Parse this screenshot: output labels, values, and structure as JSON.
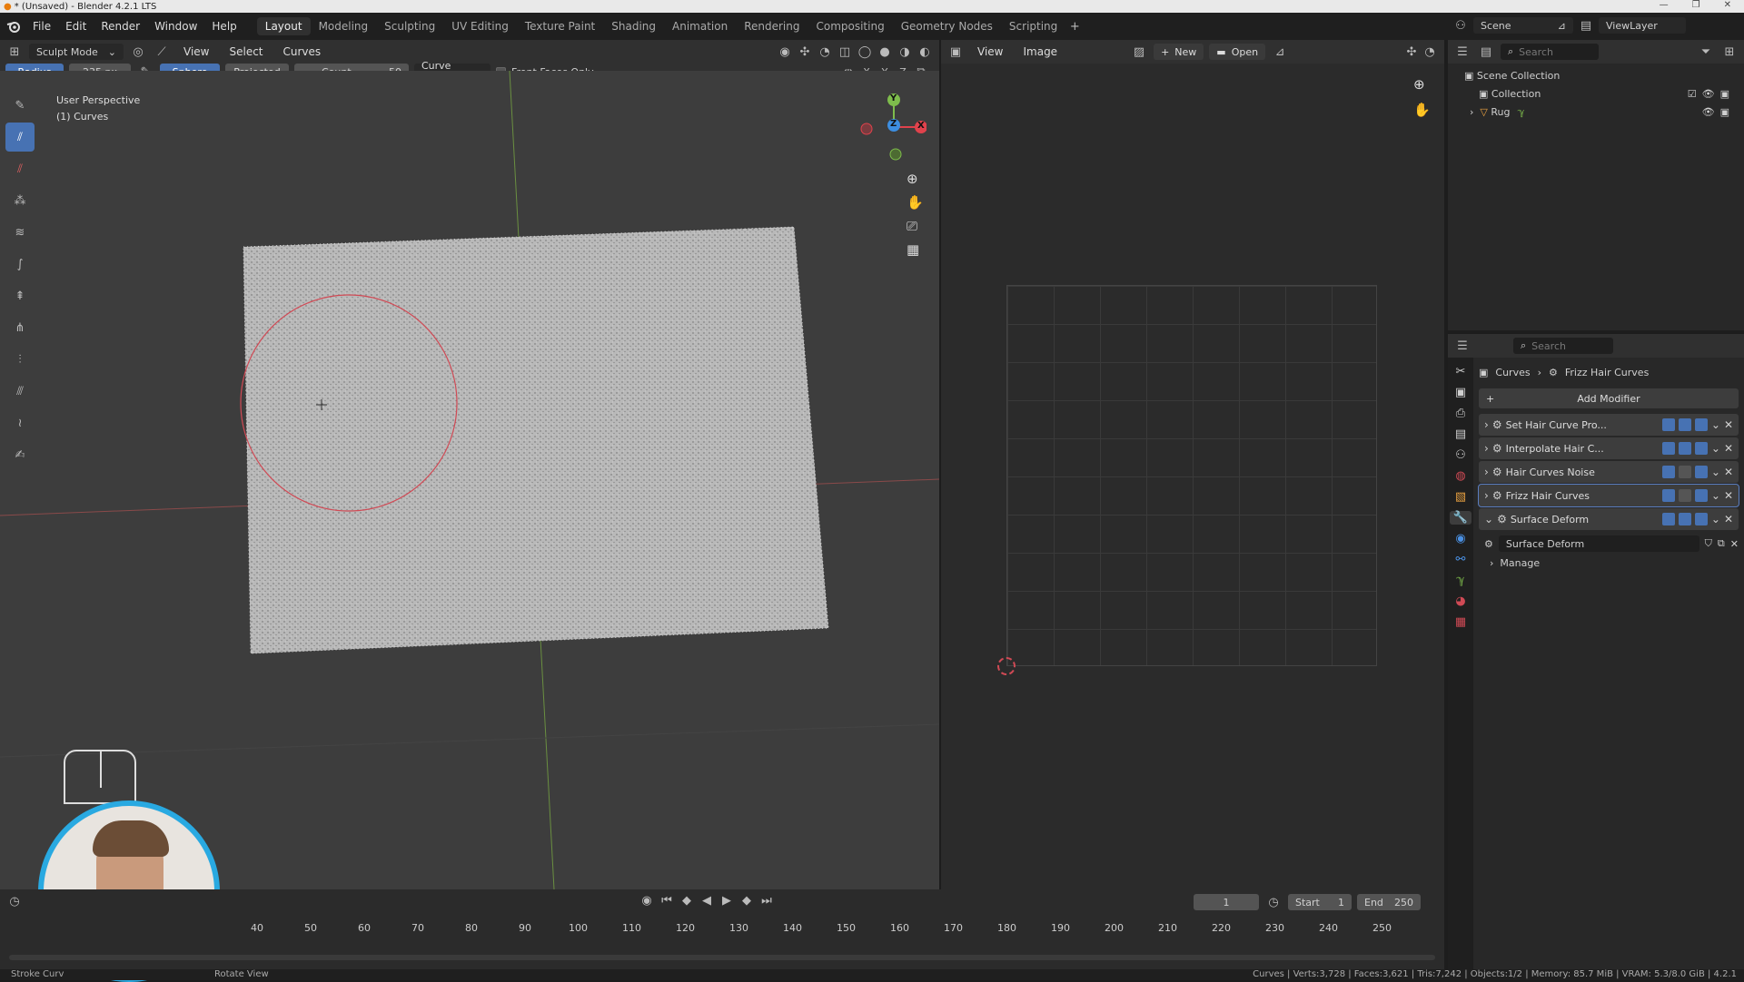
{
  "window": {
    "title": "* (Unsaved) - Blender 4.2.1 LTS"
  },
  "menu": {
    "items": [
      "File",
      "Edit",
      "Render",
      "Window",
      "Help"
    ]
  },
  "workspaces": {
    "tabs": [
      "Layout",
      "Modeling",
      "Sculpting",
      "UV Editing",
      "Texture Paint",
      "Shading",
      "Animation",
      "Rendering",
      "Compositing",
      "Geometry Nodes",
      "Scripting"
    ],
    "active": "Layout"
  },
  "scene": {
    "name": "Scene",
    "view_layer": "ViewLayer"
  },
  "viewport_header": {
    "mode": "Sculpt Mode",
    "menus": [
      "View",
      "Select",
      "Curves"
    ]
  },
  "tool_settings": {
    "radius_label": "Radius",
    "radius_value": "235 px",
    "falloff_sphere": "Sphere",
    "falloff_projected": "Projected",
    "count_label": "Count",
    "count_value": "50",
    "curve_shape": "Curve Shape",
    "front_faces": "Front Faces Only"
  },
  "viewport": {
    "perspective": "User Perspective",
    "object": "(1) Curves"
  },
  "gizmo_axes": {
    "x": "X",
    "y": "Y",
    "z": "Z"
  },
  "image_editor": {
    "menus": [
      "View",
      "Image"
    ],
    "new_label": "New",
    "open_label": "Open"
  },
  "outliner": {
    "search_placeholder": "Search",
    "root": "Scene Collection",
    "collection": "Collection",
    "object": "Rug"
  },
  "properties": {
    "search_placeholder": "Search",
    "breadcrumb_object": "Curves",
    "breadcrumb_item": "Frizz Hair Curves",
    "add_modifier": "Add Modifier",
    "modifiers": [
      {
        "name": "Set Hair Curve Pro...",
        "expanded": false
      },
      {
        "name": "Interpolate Hair C...",
        "expanded": false
      },
      {
        "name": "Hair Curves Noise",
        "expanded": false
      },
      {
        "name": "Frizz Hair Curves",
        "expanded": false
      },
      {
        "name": "Surface Deform",
        "expanded": true
      }
    ],
    "node_group": "Surface Deform",
    "manage": "Manage"
  },
  "timeline": {
    "current_frame": "1",
    "start_label": "Start",
    "start_value": "1",
    "end_label": "End",
    "end_value": "250",
    "ticks": [
      "40",
      "50",
      "60",
      "70",
      "80",
      "90",
      "100",
      "110",
      "120",
      "130",
      "140",
      "150",
      "160",
      "170",
      "180",
      "190",
      "200",
      "210",
      "220",
      "230",
      "240",
      "250"
    ]
  },
  "status": {
    "left_1": "Stroke Curv",
    "left_2": "Rotate View",
    "stats": "Curves | Verts:3,728 | Faces:3,621 | Tris:7,242 | Objects:1/2 | Memory: 85.7 MiB | VRAM: 5.3/8.0 GiB | 4.2.1"
  },
  "colors": {
    "accent": "#4772b3",
    "viewport_bg": "#3d3d3d",
    "brush_circle": "#d04a55",
    "x_axis": "#e0424c",
    "y_axis": "#7ebc4c",
    "z_axis": "#3d8ee0"
  }
}
